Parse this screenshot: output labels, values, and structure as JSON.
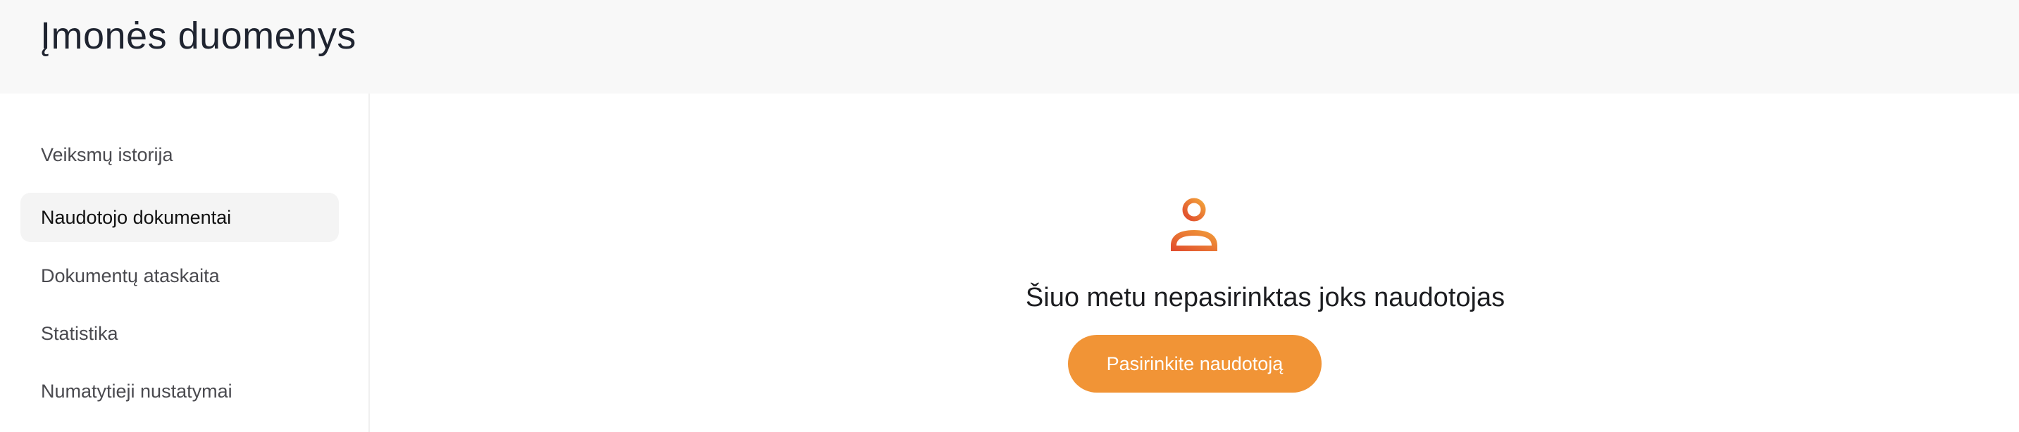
{
  "header": {
    "title": "Įmonės duomenys"
  },
  "sidebar": {
    "items": [
      {
        "label": "Veiksmų istorija",
        "active": false
      },
      {
        "label": "Naudotojo dokumentai",
        "active": true
      },
      {
        "label": "Dokumentų ataskaita",
        "active": false
      },
      {
        "label": "Statistika",
        "active": false
      },
      {
        "label": "Numatytieji nustatymai",
        "active": false
      }
    ]
  },
  "main": {
    "empty_state": {
      "icon": "user-icon",
      "message": "Šiuo metu nepasirinktas joks naudotojas",
      "button_label": "Pasirinkite naudotoją"
    }
  },
  "colors": {
    "accent": "#f19436",
    "icon_gradient_start": "#f2a23a",
    "icon_gradient_end": "#e0492d",
    "active_item_bg": "#f4f4f4",
    "header_bg": "#f8f8f8"
  }
}
